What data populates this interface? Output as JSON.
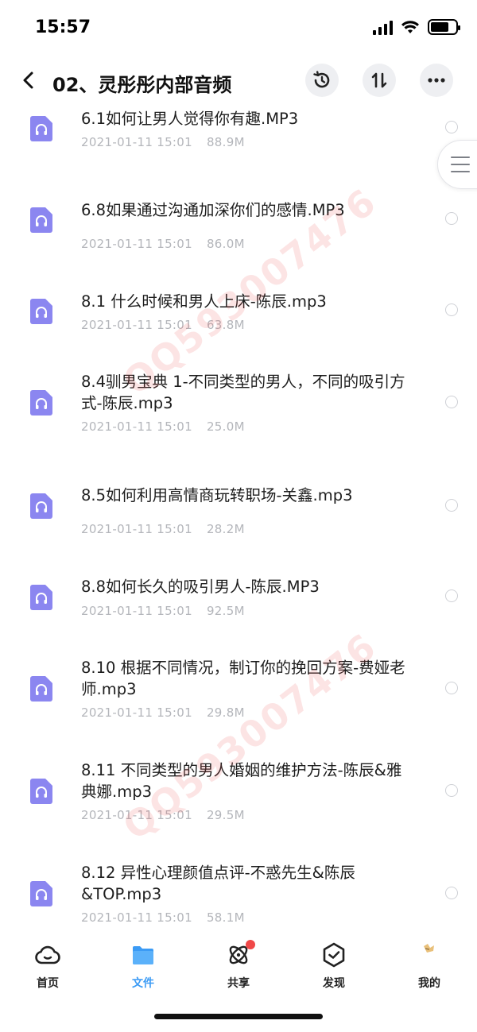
{
  "status": {
    "time": "15:57"
  },
  "header": {
    "title": "02、灵彤彤内部音频"
  },
  "watermark": "QQ593007476",
  "files": [
    {
      "name": "6.1如何让男人觉得你有趣.MP3",
      "date": "2021-01-11 15:01",
      "size": "88.9M"
    },
    {
      "name": "6.8如果通过沟通加深你们的感情.MP3",
      "date": "2021-01-11 15:01",
      "size": "86.0M"
    },
    {
      "name": "8.1 什么时候和男人上床-陈辰.mp3",
      "date": "2021-01-11 15:01",
      "size": "63.8M"
    },
    {
      "name": "8.4驯男宝典 1-不同类型的男人，不同的吸引方式-陈辰.mp3",
      "date": "2021-01-11 15:01",
      "size": "25.0M"
    },
    {
      "name": "8.5如何利用高情商玩转职场-关鑫.mp3",
      "date": "2021-01-11 15:01",
      "size": "28.2M"
    },
    {
      "name": "8.8如何长久的吸引男人-陈辰.MP3",
      "date": "2021-01-11 15:01",
      "size": "92.5M"
    },
    {
      "name": "8.10 根据不同情况，制订你的挽回方案-费娅老师.mp3",
      "date": "2021-01-11 15:01",
      "size": "29.8M"
    },
    {
      "name": "8.11 不同类型的男人婚姻的维护方法-陈辰&雅典娜.mp3",
      "date": "2021-01-11 15:01",
      "size": "29.5M"
    },
    {
      "name": "8.12 异性心理颜值点评-不惑先生&陈辰&TOP.mp3",
      "date": "2021-01-11 15:01",
      "size": "58.1M"
    }
  ],
  "tabs": [
    {
      "label": "首页",
      "icon": "cloud-icon"
    },
    {
      "label": "文件",
      "icon": "folder-icon",
      "active": true
    },
    {
      "label": "共享",
      "icon": "atom-icon",
      "badge": true
    },
    {
      "label": "发现",
      "icon": "compass-icon"
    },
    {
      "label": "我的",
      "icon": "avatar-icon"
    }
  ],
  "colors": {
    "accent": "#3b9bf5",
    "file_icon": "#8b86f0",
    "badge": "#f04848"
  }
}
